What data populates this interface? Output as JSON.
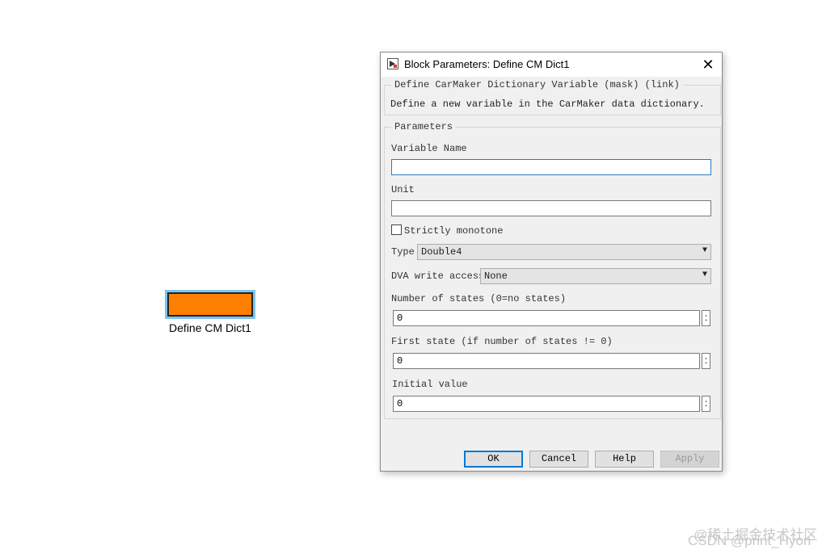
{
  "canvas": {
    "block_label": "Define CM Dict1",
    "block_color": "#ff8000",
    "selection_color": "#7cc4ec"
  },
  "dialog": {
    "title": "Block Parameters: Define CM Dict1",
    "close_icon": "close-icon",
    "description": {
      "group_title": "Define CarMaker Dictionary Variable (mask) (link)",
      "text": "Define a new variable in the CarMaker data dictionary."
    },
    "parameters": {
      "group_title": "Parameters",
      "variable_name": {
        "label": "Variable Name",
        "value": ""
      },
      "unit": {
        "label": "Unit",
        "value": ""
      },
      "strictly_monotone": {
        "label": "Strictly monotone",
        "checked": false
      },
      "type": {
        "label": "Type",
        "value": "Double4"
      },
      "dva_write_access": {
        "label": "DVA write access",
        "value": "None"
      },
      "number_of_states": {
        "label": "Number of states (0=no states)",
        "value": "0"
      },
      "first_state": {
        "label": "First state (if number of states != 0)",
        "value": "0"
      },
      "initial_value": {
        "label": "Initial value",
        "value": "0"
      },
      "ellipsis": ":"
    },
    "buttons": {
      "ok": "OK",
      "cancel": "Cancel",
      "help": "Help",
      "apply": "Apply"
    }
  },
  "watermark": {
    "line1": "@稀土掘金技术社区",
    "line2": "CSDN @print_Hyon"
  }
}
